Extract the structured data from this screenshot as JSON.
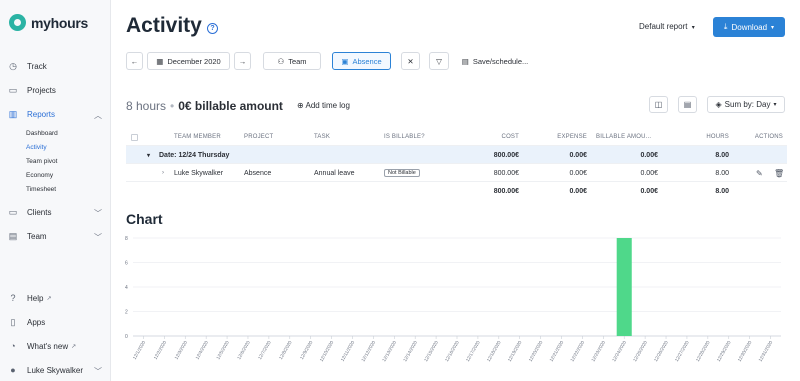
{
  "app": {
    "logo_text": "myhours",
    "brand_color": "#2bb3a4",
    "accent": "#2b82d6",
    "bar_color": "#4fd88a"
  },
  "sidebar": {
    "items": [
      {
        "label": "Track",
        "icon": "clock-icon"
      },
      {
        "label": "Projects",
        "icon": "folder-icon"
      },
      {
        "label": "Reports",
        "icon": "bar-chart-icon"
      },
      {
        "label": "Clients",
        "icon": "folder-icon"
      },
      {
        "label": "Team",
        "icon": "team-icon"
      }
    ],
    "report_sub": [
      "Dashboard",
      "Activity",
      "Team pivot",
      "Economy",
      "Timesheet"
    ],
    "bottom": [
      {
        "label": "Help",
        "icon": "help-icon"
      },
      {
        "label": "Apps",
        "icon": "phone-icon"
      },
      {
        "label": "What's new",
        "icon": "bell-icon"
      },
      {
        "label": "Luke Skywalker",
        "icon": "user-icon"
      }
    ]
  },
  "header": {
    "title": "Activity",
    "help": "?",
    "default_report": "Default report",
    "download": "Download"
  },
  "toolbar": {
    "date": "December 2020",
    "team": "Team",
    "absence": "Absence",
    "save": "Save/schedule..."
  },
  "summary": {
    "hours": "8 hours",
    "billable": "0€ billable amount",
    "add_time_log": "Add time log",
    "sum_by": "Sum by: Day"
  },
  "table": {
    "columns": [
      "TEAM MEMBER",
      "PROJECT",
      "TASK",
      "IS BILLABLE?",
      "COST",
      "EXPENSE",
      "BILLABLE AMOU...",
      "HOURS",
      "ACTIONS"
    ],
    "group": {
      "label": "Date: 12/24 Thursday",
      "cost": "800.00€",
      "expense": "0.00€",
      "billable": "0.00€",
      "hours": "8.00"
    },
    "row": {
      "member": "Luke Skywalker",
      "project": "Absence",
      "task": "Annual leave",
      "billable_badge": "Not Billable",
      "cost": "800.00€",
      "expense": "0.00€",
      "billable": "0.00€",
      "hours": "8.00"
    },
    "total": {
      "cost": "800.00€",
      "expense": "0.00€",
      "billable": "0.00€",
      "hours": "8.00"
    }
  },
  "chart": {
    "title": "Chart"
  },
  "chart_data": {
    "type": "bar",
    "categories": [
      "12/1/2020",
      "12/2/2020",
      "12/3/2020",
      "12/4/2020",
      "12/5/2020",
      "12/6/2020",
      "12/7/2020",
      "12/8/2020",
      "12/9/2020",
      "12/10/2020",
      "12/11/2020",
      "12/12/2020",
      "12/13/2020",
      "12/14/2020",
      "12/15/2020",
      "12/16/2020",
      "12/17/2020",
      "12/18/2020",
      "12/19/2020",
      "12/20/2020",
      "12/21/2020",
      "12/22/2020",
      "12/23/2020",
      "12/24/2020",
      "12/25/2020",
      "12/26/2020",
      "12/27/2020",
      "12/28/2020",
      "12/29/2020",
      "12/30/2020",
      "12/31/2020"
    ],
    "values": [
      0,
      0,
      0,
      0,
      0,
      0,
      0,
      0,
      0,
      0,
      0,
      0,
      0,
      0,
      0,
      0,
      0,
      0,
      0,
      0,
      0,
      0,
      0,
      8,
      0,
      0,
      0,
      0,
      0,
      0,
      0
    ],
    "yticks": [
      0,
      2,
      4,
      6,
      8
    ],
    "ylim": [
      0,
      8
    ],
    "grid": true
  }
}
